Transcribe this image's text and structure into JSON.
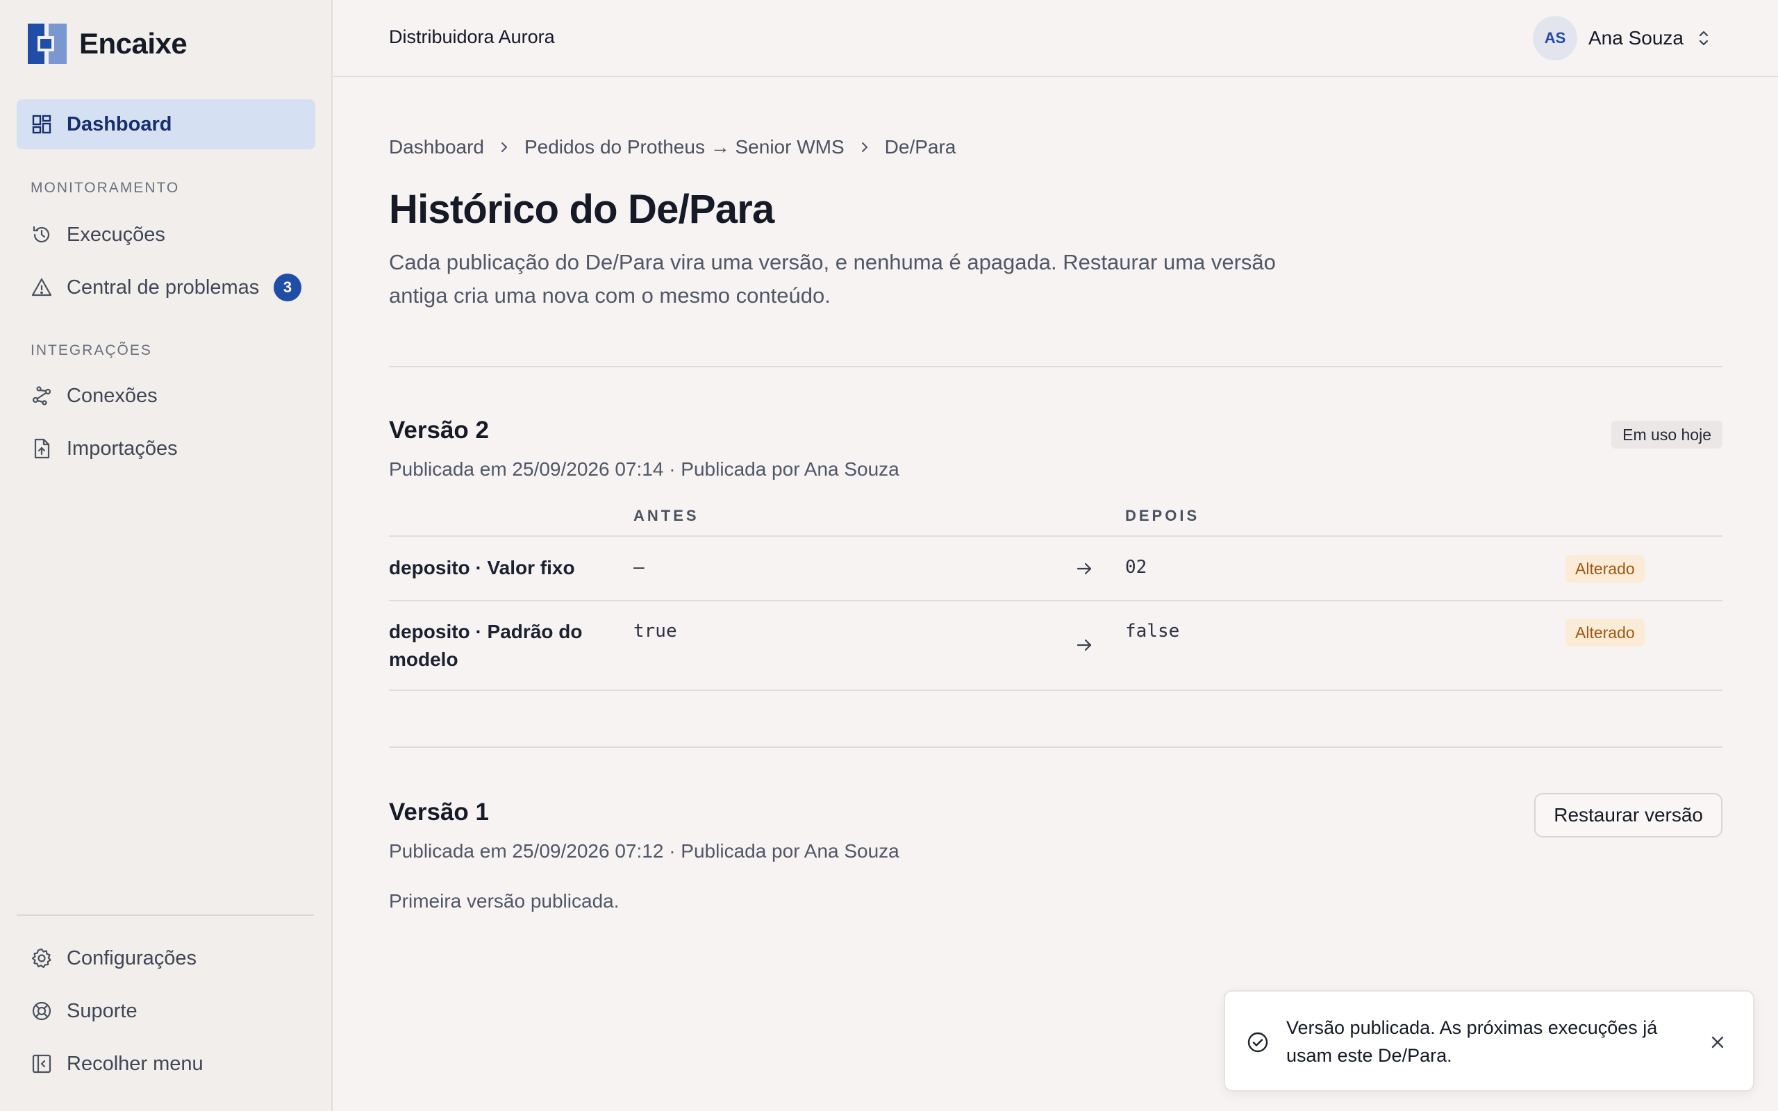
{
  "brand": {
    "name": "Encaixe",
    "logo_colors": [
      "#1f4da8",
      "#7b97d2"
    ]
  },
  "sidebar": {
    "dashboard": {
      "label": "Dashboard",
      "icon": "grid-icon"
    },
    "section_monitoring": "MONITORAMENTO",
    "executions": {
      "label": "Execuções",
      "icon": "history-icon"
    },
    "problems": {
      "label": "Central de problemas",
      "icon": "warning-icon",
      "count": "3"
    },
    "section_integrations": "INTEGRAÇÕES",
    "connections": {
      "label": "Conexões",
      "icon": "connections-icon"
    },
    "imports": {
      "label": "Importações",
      "icon": "file-upload-icon"
    },
    "settings": {
      "label": "Configurações",
      "icon": "gear-icon"
    },
    "support": {
      "label": "Suporte",
      "icon": "lifebuoy-icon"
    },
    "collapse": {
      "label": "Recolher menu",
      "icon": "collapse-sidebar-icon"
    }
  },
  "header": {
    "org_name": "Distribuidora Aurora",
    "user_initials": "AS",
    "user_name": "Ana Souza"
  },
  "breadcrumb": [
    "Dashboard",
    "Pedidos do Protheus → Senior WMS",
    "De/Para"
  ],
  "page": {
    "title": "Histórico do De/Para",
    "description": "Cada publicação do De/Para vira uma versão, e nenhuma é apagada. Restaurar uma versão antiga cria uma nova com o mesmo conteúdo."
  },
  "versions": [
    {
      "title": "Versão 2",
      "meta": "Publicada em 25/09/2026 07:14 · Publicada por Ana Souza",
      "current_tag": "Em uso hoje",
      "columns": {
        "before": "ANTES",
        "after": "DEPOIS"
      },
      "changes": [
        {
          "field": "deposito · Valor fixo",
          "before": "—",
          "after": "02",
          "status": "Alterado"
        },
        {
          "field": "deposito · Padrão do modelo",
          "before": "true",
          "after": "false",
          "status": "Alterado"
        }
      ]
    },
    {
      "title": "Versão 1",
      "meta": "Publicada em 25/09/2026 07:12 · Publicada por Ana Souza",
      "restore_label": "Restaurar versão",
      "note": "Primeira versão publicada."
    }
  ],
  "toast": {
    "message": "Versão publicada. As próximas execuções já usam este De/Para.",
    "icon": "check-circle-icon",
    "close_icon": "close-icon"
  },
  "colors": {
    "accent": "#1f4da8",
    "active_nav_bg": "#d5e1f3",
    "status_bg": "#fcebd6",
    "status_text": "#9a5a14"
  }
}
